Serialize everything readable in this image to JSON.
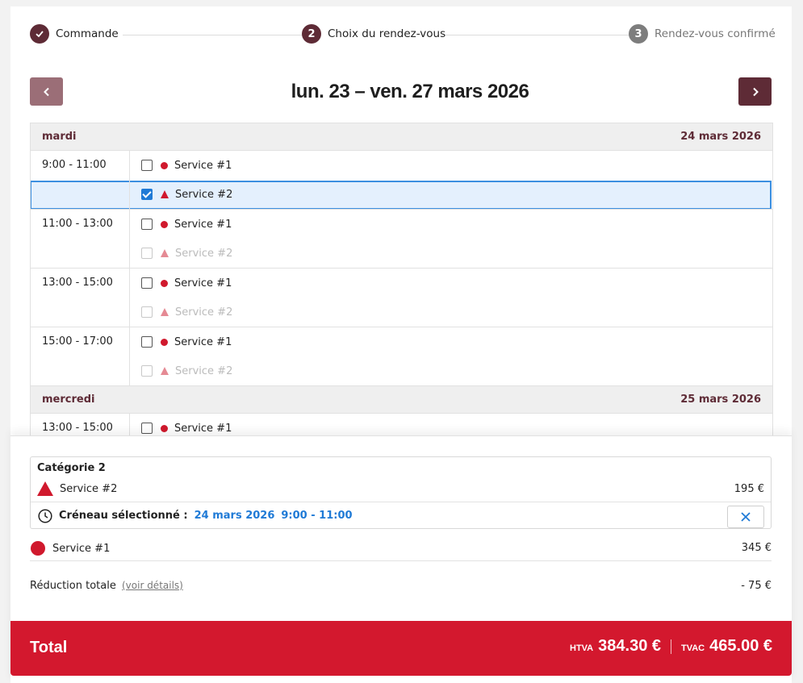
{
  "stepper": {
    "steps": [
      {
        "num": "",
        "label": "Commande"
      },
      {
        "num": "2",
        "label": "Choix du rendez-vous"
      },
      {
        "num": "3",
        "label": "Rendez-vous confirmé"
      }
    ]
  },
  "week": {
    "title": "lun. 23 – ven. 27 mars 2026"
  },
  "schedule": {
    "days": [
      {
        "name": "mardi",
        "date": "24 mars 2026",
        "slots": [
          {
            "time": "9:00 - 11:00",
            "options": [
              {
                "label": "Service #1"
              },
              {
                "label": "Service #2"
              }
            ]
          },
          {
            "time": "11:00 - 13:00",
            "options": [
              {
                "label": "Service #1"
              },
              {
                "label": "Service #2"
              }
            ]
          },
          {
            "time": "13:00 - 15:00",
            "options": [
              {
                "label": "Service #1"
              },
              {
                "label": "Service #2"
              }
            ]
          },
          {
            "time": "15:00 - 17:00",
            "options": [
              {
                "label": "Service #1"
              },
              {
                "label": "Service #2"
              }
            ]
          }
        ]
      },
      {
        "name": "mercredi",
        "date": "25 mars 2026",
        "slots": [
          {
            "time": "13:00 - 15:00",
            "options": [
              {
                "label": "Service #1"
              }
            ]
          }
        ]
      }
    ]
  },
  "summary": {
    "category": {
      "title": "Catégorie 2",
      "service": "Service #2",
      "price": "195 €",
      "slot_label": "Créneau sélectionné :",
      "slot_date": "24 mars 2026",
      "slot_time": "9:00 - 11:00"
    },
    "service1": {
      "label": "Service #1",
      "price": "345 €"
    },
    "reduction": {
      "label": "Réduction totale",
      "link": "(voir détails)",
      "value": "- 75 €"
    },
    "total": {
      "label": "Total",
      "htva_label": "HTVA",
      "htva_value": "384.30 €",
      "tvac_label": "TVAC",
      "tvac_value": "465.00 €"
    }
  },
  "colors": {
    "brand": "#5e2b36",
    "accent": "#d0192d",
    "selected": "#1f7ad6"
  }
}
